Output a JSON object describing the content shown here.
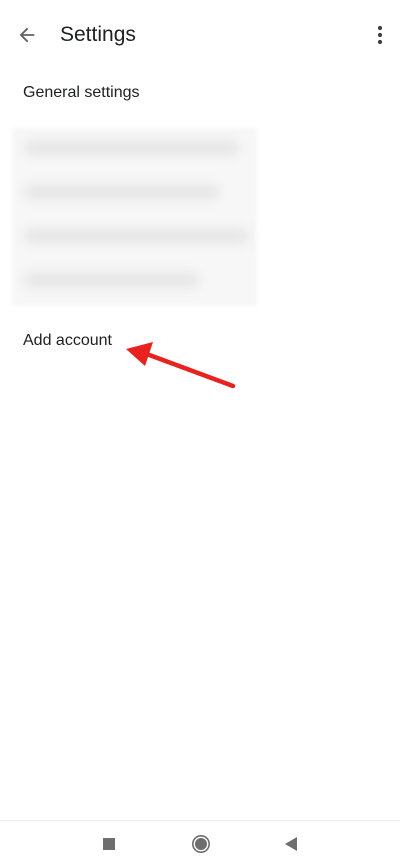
{
  "appbar": {
    "title": "Settings",
    "back_icon": "arrow-left-icon",
    "overflow_icon": "more-vert-icon"
  },
  "list": {
    "general_settings": "General settings",
    "add_account": "Add account"
  },
  "annotation": {
    "arrow_color": "#e8231f"
  },
  "navbar": {
    "recent_icon": "square-icon",
    "home_icon": "circle-icon",
    "back_icon": "triangle-back-icon"
  }
}
